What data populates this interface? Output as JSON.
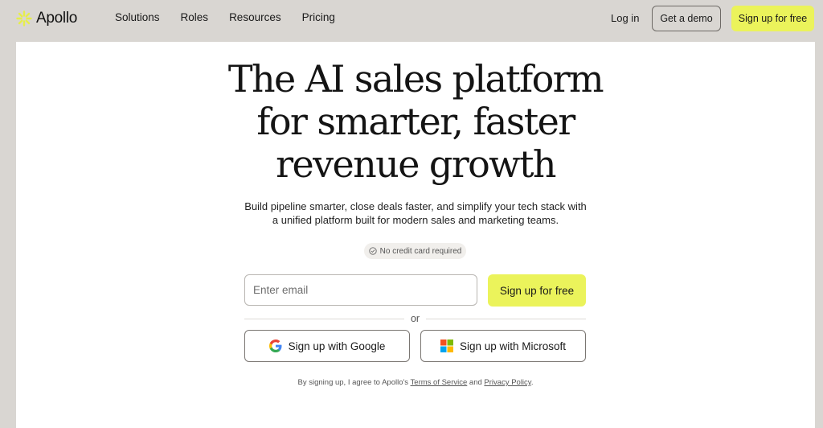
{
  "nav": {
    "logo_text": "Apollo",
    "links": [
      "Solutions",
      "Roles",
      "Resources",
      "Pricing"
    ],
    "login": "Log in",
    "demo": "Get a demo",
    "signup": "Sign up for free"
  },
  "hero": {
    "headline": [
      "The AI sales platform",
      "for smarter, faster",
      "revenue growth"
    ],
    "subtitle_line1": "Build pipeline smarter, close deals faster, and simplify your tech stack with",
    "subtitle_line2": "a unified platform built for modern sales and marketing teams.",
    "badge": "No credit card required"
  },
  "form": {
    "email_placeholder": "Enter email",
    "email_value": "",
    "signup": "Sign up for free",
    "or": "or",
    "google": "Sign up with Google",
    "microsoft": "Sign up with Microsoft"
  },
  "legal": {
    "prefix": "By signing up, I agree to Apollo's",
    "terms": "Terms of Service",
    "and": "and",
    "privacy": "Privacy Policy",
    "suffix": "."
  },
  "colors": {
    "accent": "#ebf35b",
    "frame": "#d9d6d2",
    "card": "#ffffff",
    "logo_mark": "#ebf35b"
  },
  "icons": {
    "logo": "apollo-sunburst-icon",
    "badge": "check-circle-icon",
    "google": "google-icon",
    "microsoft": "microsoft-icon"
  }
}
